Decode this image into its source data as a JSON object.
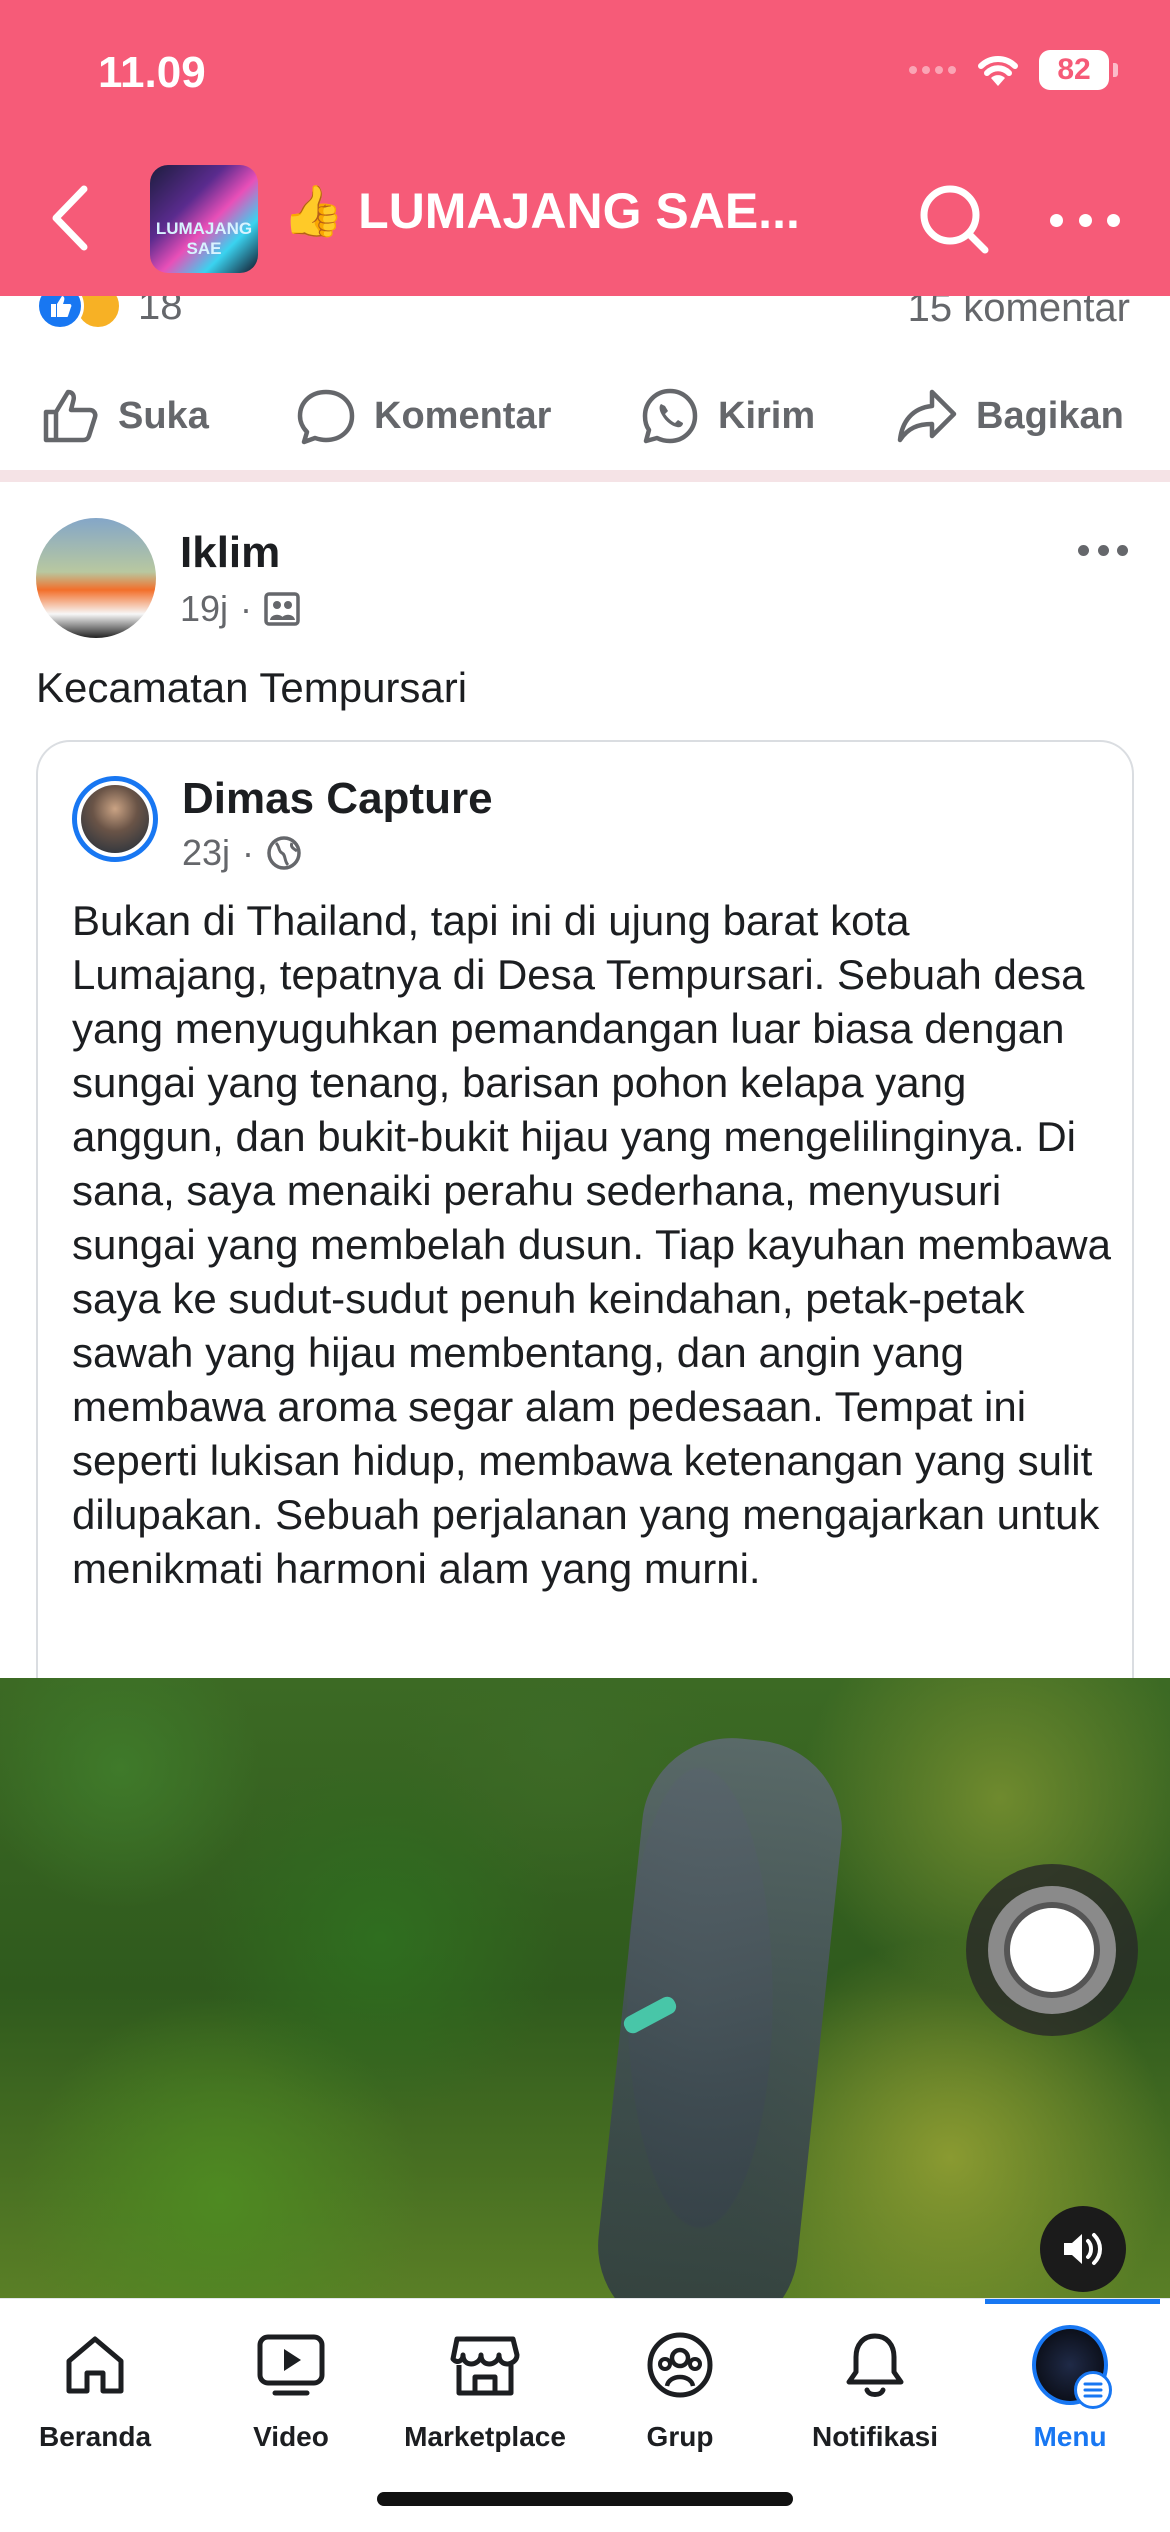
{
  "status_bar": {
    "time": "11.09",
    "battery": "82"
  },
  "header": {
    "group_title": "👍 LUMAJANG SAE...",
    "group_thumb_text": "LUMAJANG SAE"
  },
  "prev_post": {
    "reaction_count": "18",
    "comment_count": "15 komentar",
    "actions": {
      "like": "Suka",
      "comment": "Komentar",
      "send": "Kirim",
      "share": "Bagikan"
    }
  },
  "post": {
    "author": "Iklim",
    "time": "19j",
    "text": "Kecamatan Tempursari",
    "shared": {
      "author": "Dimas Capture",
      "time": "23j",
      "body": "Bukan di Thailand, tapi ini di ujung barat kota Lumajang, tepatnya di Desa Tempursari. Sebuah desa yang menyuguhkan pemandangan luar biasa dengan sungai yang tenang, barisan pohon kelapa yang anggun, dan bukit-bukit hijau yang mengelilinginya. Di sana, saya menaiki perahu sederhana, menyusuri sungai yang membelah dusun. Tiap kayuhan membawa saya ke sudut-sudut penuh keindahan, petak-petak sawah yang hijau membentang, dan angin yang membawa aroma segar alam pedesaan. Tempat ini seperti lukisan hidup, membawa ketenangan yang sulit dilupakan. Sebuah perjalanan yang mengajarkan untuk menikmati harmoni alam yang murni."
    }
  },
  "nav": {
    "items": [
      {
        "label": "Beranda",
        "icon": "home-icon"
      },
      {
        "label": "Video",
        "icon": "video-icon"
      },
      {
        "label": "Marketplace",
        "icon": "marketplace-icon"
      },
      {
        "label": "Grup",
        "icon": "groups-icon"
      },
      {
        "label": "Notifikasi",
        "icon": "bell-icon"
      },
      {
        "label": "Menu",
        "icon": "menu-avatar"
      }
    ],
    "active": "Menu"
  },
  "colors": {
    "header_bg": "#f65b78",
    "accent": "#1877f2"
  }
}
